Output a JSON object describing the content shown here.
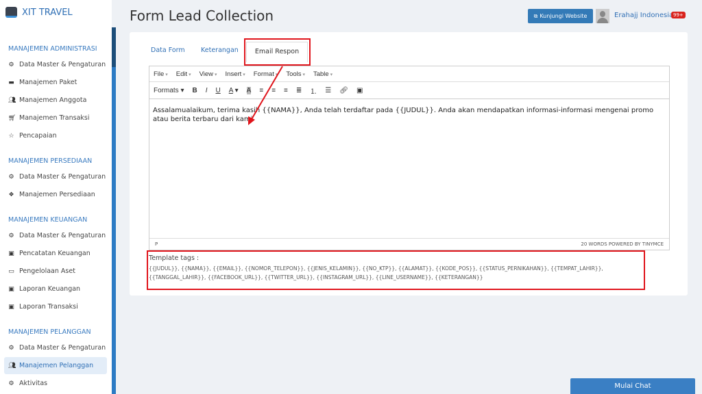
{
  "brand": "XIT TRAVEL",
  "sidebar": {
    "sections": [
      {
        "title": "MANAJEMEN ADMINISTRASI",
        "items": [
          {
            "label": "Data Master & Pengaturan",
            "icon": "cogs-icon"
          },
          {
            "label": "Manajemen Paket",
            "icon": "book-icon"
          },
          {
            "label": "Manajemen Anggota",
            "icon": "users-icon"
          },
          {
            "label": "Manajemen Transaksi",
            "icon": "cart-icon"
          },
          {
            "label": "Pencapaian",
            "icon": "star-icon"
          }
        ]
      },
      {
        "title": "MANAJEMEN PERSEDIAAN",
        "items": [
          {
            "label": "Data Master & Pengaturan",
            "icon": "cogs-icon"
          },
          {
            "label": "Manajemen Persediaan",
            "icon": "cubes-icon"
          }
        ]
      },
      {
        "title": "MANAJEMEN KEUANGAN",
        "items": [
          {
            "label": "Data Master & Pengaturan",
            "icon": "cogs-icon"
          },
          {
            "label": "Pencatatan Keuangan",
            "icon": "money-icon"
          },
          {
            "label": "Pengelolaan Aset",
            "icon": "hdd-icon"
          },
          {
            "label": "Laporan Keuangan",
            "icon": "money-icon"
          },
          {
            "label": "Laporan Transaksi",
            "icon": "money-icon"
          }
        ]
      },
      {
        "title": "MANAJEMEN PELANGGAN",
        "items": [
          {
            "label": "Data Master & Pengaturan",
            "icon": "cogs-icon"
          },
          {
            "label": "Manajemen Pelanggan",
            "icon": "users-icon",
            "active": true
          },
          {
            "label": "Aktivitas",
            "icon": "gear-icon"
          }
        ]
      }
    ]
  },
  "header": {
    "title": "Form Lead Collection",
    "visit_label": "Kunjungi Website",
    "user": "Erahajj Indonesia",
    "badge": "99+"
  },
  "tabs": [
    "Data Form",
    "Keterangan",
    "Email Respon"
  ],
  "editor": {
    "menu": [
      "File",
      "Edit",
      "View",
      "Insert",
      "Format",
      "Tools",
      "Table"
    ],
    "formats": "Formats",
    "content": "Assalamualaikum, terima kasih {{NAMA}}, Anda telah terdaftar pada {{JUDUL}}. Anda akan mendapatkan informasi-informasi mengenai promo atau berita terbaru dari kami",
    "path": "P",
    "wordcount": "20 WORDS POWERED BY TINYMCE"
  },
  "template": {
    "label": "Template tags :",
    "tags": "{{JUDUL}}, {{NAMA}}, {{EMAIL}}, {{NOMOR_TELEPON}}, {{JENIS_KELAMIN}}, {{NO_KTP}}, {{ALAMAT}}, {{KODE_POS}}, {{STATUS_PERNIKAHAN}}, {{TEMPAT_LAHIR}}, {{TANGGAL_LAHIR}}, {{FACEBOOK_URL}}, {{TWITTER_URL}}, {{INSTAGRAM_URL}}, {{LINE_USERNAME}}, {{KETERANGAN}}"
  },
  "chat_label": "Mulai Chat",
  "colors": {
    "accent": "#2f6fb5",
    "button": "#337ab7",
    "highlight": "#e0141b"
  }
}
